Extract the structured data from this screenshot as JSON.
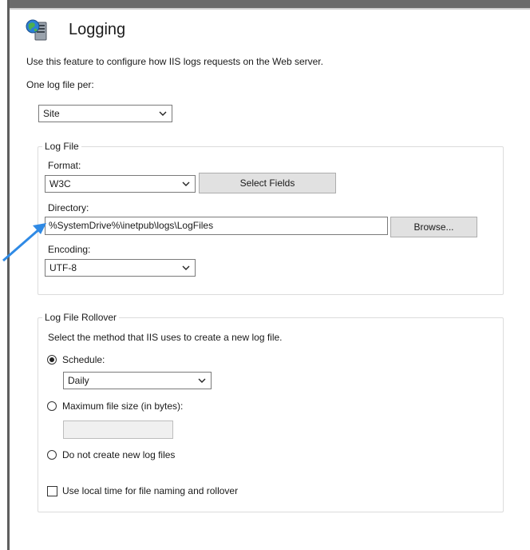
{
  "header": {
    "title": "Logging",
    "icon": "server-globe-icon"
  },
  "description": "Use this feature to configure how IIS logs requests on the Web server.",
  "one_log_file_per": {
    "label": "One log file per:",
    "value": "Site"
  },
  "log_file": {
    "group_title": "Log File",
    "format_label": "Format:",
    "format_value": "W3C",
    "select_fields_label": "Select Fields",
    "directory_label": "Directory:",
    "directory_value": "%SystemDrive%\\inetpub\\logs\\LogFiles",
    "browse_label": "Browse...",
    "encoding_label": "Encoding:",
    "encoding_value": "UTF-8"
  },
  "rollover": {
    "group_title": "Log File Rollover",
    "instruction": "Select the method that IIS uses to create a new log file.",
    "schedule_label": "Schedule:",
    "schedule_value": "Daily",
    "max_size_label": "Maximum file size (in bytes):",
    "max_size_value": "",
    "no_new_label": "Do not create new log files",
    "local_time_label": "Use local time for file naming and rollover",
    "selected_method": "Schedule",
    "local_time_checked": false
  },
  "colors": {
    "annotation_arrow": "#2f8ae5",
    "button_face": "#e1e1e1",
    "frame": "#5e5e5e"
  }
}
